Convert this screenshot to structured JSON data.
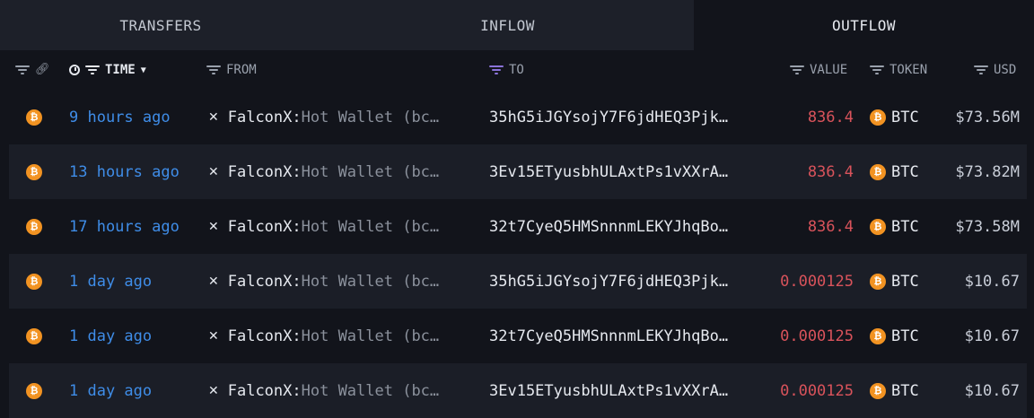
{
  "tabs": [
    {
      "label": "TRANSFERS"
    },
    {
      "label": "INFLOW"
    },
    {
      "label": "OUTFLOW",
      "active": true
    }
  ],
  "columns": {
    "time": "TIME",
    "from": "FROM",
    "to": "TO",
    "value": "VALUE",
    "token": "TOKEN",
    "usd": "USD"
  },
  "rows": [
    {
      "time": "9 hours ago",
      "from_entity": "FalconX:",
      "from_wallet": " Hot Wallet (bc…",
      "to": "35hG5iJGYsojY7F6jdHEQ3Pjk…",
      "value": "836.4",
      "token": "BTC",
      "usd": "$73.56M"
    },
    {
      "time": "13 hours ago",
      "from_entity": "FalconX:",
      "from_wallet": " Hot Wallet (bc…",
      "to": "3Ev15ETyusbhULAxtPs1vXXrA…",
      "value": "836.4",
      "token": "BTC",
      "usd": "$73.82M"
    },
    {
      "time": "17 hours ago",
      "from_entity": "FalconX:",
      "from_wallet": " Hot Wallet (bc…",
      "to": "32t7CyeQ5HMSnnnmLEKYJhqBo…",
      "value": "836.4",
      "token": "BTC",
      "usd": "$73.58M"
    },
    {
      "time": "1 day ago",
      "from_entity": "FalconX:",
      "from_wallet": " Hot Wallet (bc…",
      "to": "35hG5iJGYsojY7F6jdHEQ3Pjk…",
      "value": "0.000125",
      "token": "BTC",
      "usd": "$10.67"
    },
    {
      "time": "1 day ago",
      "from_entity": "FalconX:",
      "from_wallet": " Hot Wallet (bc…",
      "to": "32t7CyeQ5HMSnnnmLEKYJhqBo…",
      "value": "0.000125",
      "token": "BTC",
      "usd": "$10.67"
    },
    {
      "time": "1 day ago",
      "from_entity": "FalconX:",
      "from_wallet": " Hot Wallet (bc…",
      "to": "3Ev15ETyusbhULAxtPs1vXXrA…",
      "value": "0.000125",
      "token": "BTC",
      "usd": "$10.67"
    }
  ],
  "colors": {
    "accent_blue": "#3f8de8",
    "value_red": "#d9535b",
    "btc_orange": "#f29322"
  },
  "icons": {
    "chain": "bitcoin-icon",
    "from_entity": "x-icon"
  }
}
